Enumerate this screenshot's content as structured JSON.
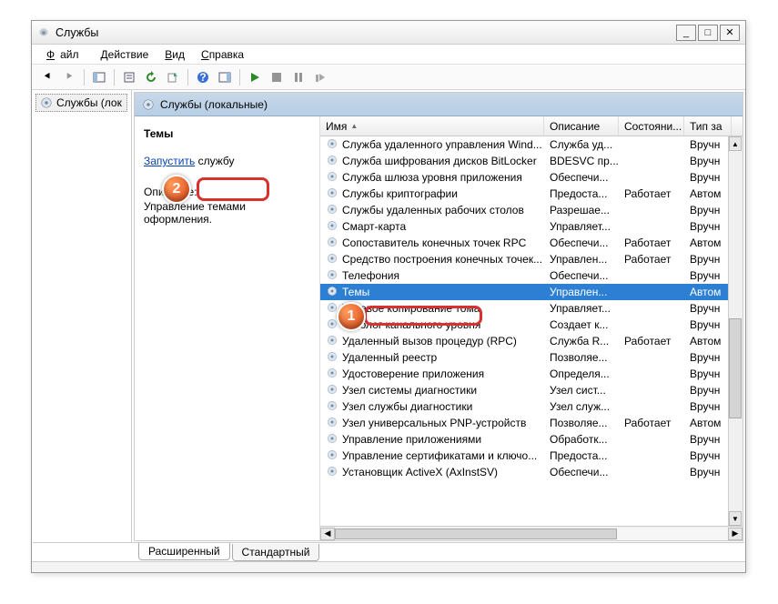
{
  "window": {
    "title": "Службы"
  },
  "menu": {
    "file": "Файл",
    "action": "Действие",
    "view": "Вид",
    "help": "Справка"
  },
  "tree": {
    "root": "Службы (лок"
  },
  "header": {
    "title": "Службы (локальные)"
  },
  "detail": {
    "serviceName": "Темы",
    "actionLink": "Запустить",
    "actionSuffix": " службу",
    "descLabel": "Описание:",
    "descText": "Управление темами оформления."
  },
  "columns": {
    "name": "Имя",
    "desc": "Описание",
    "state": "Состояни...",
    "type": "Тип за"
  },
  "rows": [
    {
      "name": "Служба удаленного управления Wind...",
      "desc": "Служба уд...",
      "state": "",
      "type": "Вручн"
    },
    {
      "name": "Служба шифрования дисков BitLocker",
      "desc": "BDESVC пр...",
      "state": "",
      "type": "Вручн"
    },
    {
      "name": "Служба шлюза уровня приложения",
      "desc": "Обеспечи...",
      "state": "",
      "type": "Вручн"
    },
    {
      "name": "Службы криптографии",
      "desc": "Предоста...",
      "state": "Работает",
      "type": "Автом"
    },
    {
      "name": "Службы удаленных рабочих столов",
      "desc": "Разрешае...",
      "state": "",
      "type": "Вручн"
    },
    {
      "name": "Смарт-карта",
      "desc": "Управляет...",
      "state": "",
      "type": "Вручн"
    },
    {
      "name": "Сопоставитель конечных точек RPC",
      "desc": "Обеспечи...",
      "state": "Работает",
      "type": "Автом"
    },
    {
      "name": "Средство построения конечных точек...",
      "desc": "Управлен...",
      "state": "Работает",
      "type": "Вручн"
    },
    {
      "name": "Телефония",
      "desc": "Обеспечи...",
      "state": "",
      "type": "Вручн"
    },
    {
      "name": "Темы",
      "desc": "Управлен...",
      "state": "",
      "type": "Автом",
      "selected": true
    },
    {
      "name": "Теневое копирование тома",
      "desc": "Управляет...",
      "state": "",
      "type": "Вручн"
    },
    {
      "name": "Тополог канального уровня",
      "desc": "Создает к...",
      "state": "",
      "type": "Вручн"
    },
    {
      "name": "Удаленный вызов процедур (RPC)",
      "desc": "Служба R...",
      "state": "Работает",
      "type": "Автом"
    },
    {
      "name": "Удаленный реестр",
      "desc": "Позволяе...",
      "state": "",
      "type": "Вручн"
    },
    {
      "name": "Удостоверение приложения",
      "desc": "Определя...",
      "state": "",
      "type": "Вручн"
    },
    {
      "name": "Узел системы диагностики",
      "desc": "Узел сист...",
      "state": "",
      "type": "Вручн"
    },
    {
      "name": "Узел службы диагностики",
      "desc": "Узел служ...",
      "state": "",
      "type": "Вручн"
    },
    {
      "name": "Узел универсальных PNP-устройств",
      "desc": "Позволяе...",
      "state": "Работает",
      "type": "Автом"
    },
    {
      "name": "Управление приложениями",
      "desc": "Обработк...",
      "state": "",
      "type": "Вручн"
    },
    {
      "name": "Управление сертификатами и ключо...",
      "desc": "Предоста...",
      "state": "",
      "type": "Вручн"
    },
    {
      "name": "Установщик ActiveX (AxInstSV)",
      "desc": "Обеспечи...",
      "state": "",
      "type": "Вручн"
    }
  ],
  "tabs": {
    "extended": "Расширенный",
    "standard": "Стандартный"
  },
  "callouts": {
    "one": "1",
    "two": "2"
  }
}
